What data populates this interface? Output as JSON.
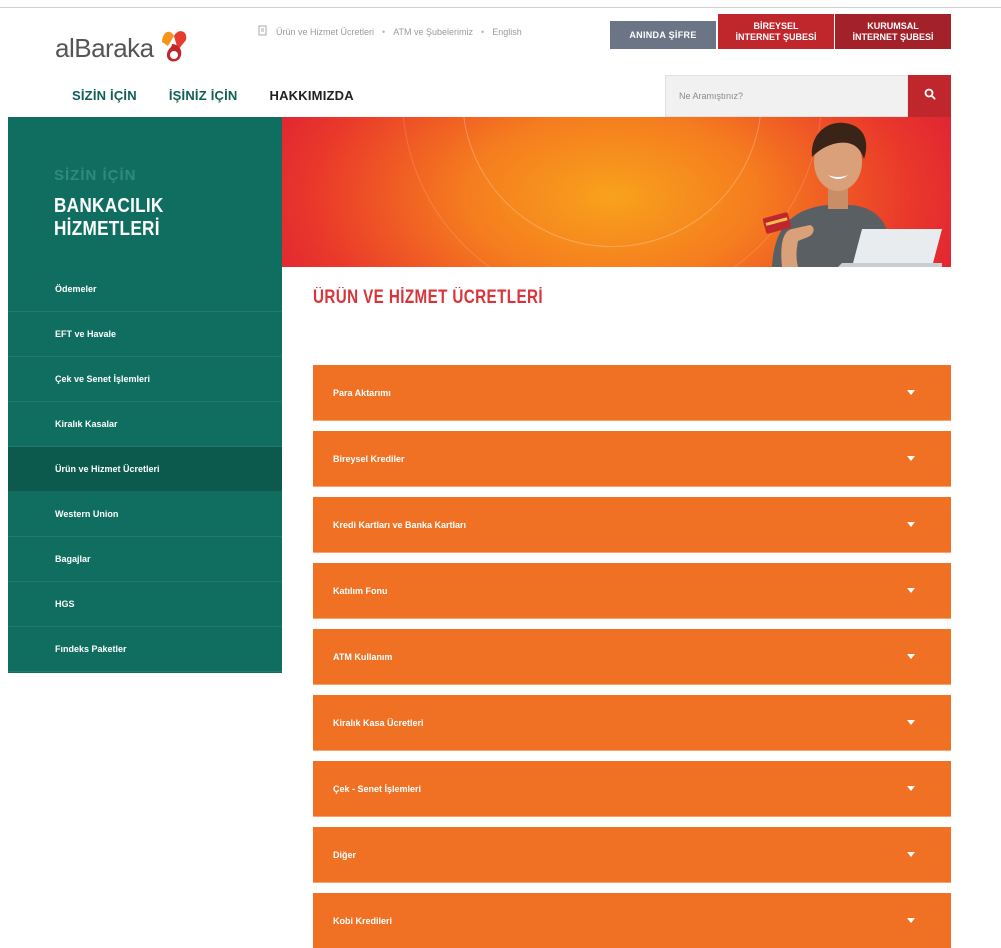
{
  "header": {
    "logo_text": "alBaraka",
    "links": [
      "Ürün ve Hizmet Ücretleri",
      "ATM ve Şubelerimiz",
      "English"
    ],
    "buttons": {
      "sifre": "ANINDA ŞİFRE",
      "bireysel_line1": "BİREYSEL",
      "bireysel_line2": "İNTERNET ŞUBESİ",
      "kurumsal_line1": "KURUMSAL",
      "kurumsal_line2": "İNTERNET ŞUBESİ"
    },
    "nav": [
      "SİZİN İÇİN",
      "İŞİNİZ İÇİN",
      "HAKKIMIZDA"
    ],
    "search": {
      "placeholder": "Ne Aramıştınız?"
    }
  },
  "hero": {
    "kicker": "SİZİN İÇİN",
    "title": "BANKACILIK HİZMETLERİ"
  },
  "sidebar": {
    "items": [
      {
        "label": "Ödemeler"
      },
      {
        "label": "EFT ve Havale"
      },
      {
        "label": "Çek ve Senet İşlemleri"
      },
      {
        "label": "Kiralık Kasalar"
      },
      {
        "label": "Ürün ve Hizmet Ücretleri",
        "active": true
      },
      {
        "label": "Western Union"
      },
      {
        "label": "Bagajlar"
      },
      {
        "label": "HGS"
      },
      {
        "label": "Fındeks Paketler"
      }
    ]
  },
  "content": {
    "title": "ÜRÜN VE HİZMET ÜCRETLERİ",
    "accordion": [
      "Para Aktarımı",
      "Bireysel Krediler",
      "Kredi Kartları ve Banka Kartları",
      "Katılım Fonu",
      "ATM Kullanım",
      "Kiralık Kasa Ücretleri",
      "Çek - Senet İşlemleri",
      "Diğer",
      "Kobi Kredileri"
    ]
  },
  "colors": {
    "brand_green": "#0f6e5f",
    "brand_red": "#c0272d",
    "accordion_orange": "#f07124"
  }
}
